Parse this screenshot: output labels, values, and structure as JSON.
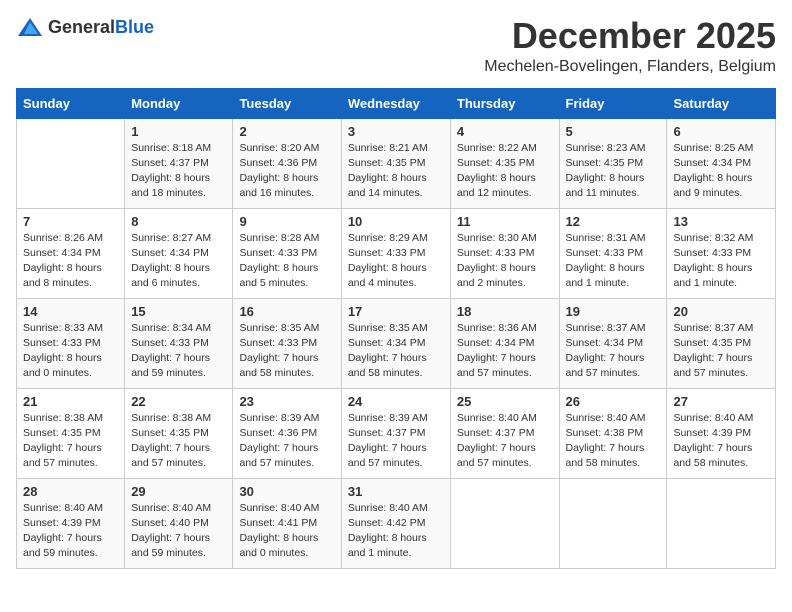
{
  "logo": {
    "general": "General",
    "blue": "Blue"
  },
  "title": {
    "month": "December 2025",
    "location": "Mechelen-Bovelingen, Flanders, Belgium"
  },
  "calendar": {
    "headers": [
      "Sunday",
      "Monday",
      "Tuesday",
      "Wednesday",
      "Thursday",
      "Friday",
      "Saturday"
    ],
    "rows": [
      [
        {
          "day": "",
          "info": ""
        },
        {
          "day": "1",
          "info": "Sunrise: 8:18 AM\nSunset: 4:37 PM\nDaylight: 8 hours\nand 18 minutes."
        },
        {
          "day": "2",
          "info": "Sunrise: 8:20 AM\nSunset: 4:36 PM\nDaylight: 8 hours\nand 16 minutes."
        },
        {
          "day": "3",
          "info": "Sunrise: 8:21 AM\nSunset: 4:35 PM\nDaylight: 8 hours\nand 14 minutes."
        },
        {
          "day": "4",
          "info": "Sunrise: 8:22 AM\nSunset: 4:35 PM\nDaylight: 8 hours\nand 12 minutes."
        },
        {
          "day": "5",
          "info": "Sunrise: 8:23 AM\nSunset: 4:35 PM\nDaylight: 8 hours\nand 11 minutes."
        },
        {
          "day": "6",
          "info": "Sunrise: 8:25 AM\nSunset: 4:34 PM\nDaylight: 8 hours\nand 9 minutes."
        }
      ],
      [
        {
          "day": "7",
          "info": "Sunrise: 8:26 AM\nSunset: 4:34 PM\nDaylight: 8 hours\nand 8 minutes."
        },
        {
          "day": "8",
          "info": "Sunrise: 8:27 AM\nSunset: 4:34 PM\nDaylight: 8 hours\nand 6 minutes."
        },
        {
          "day": "9",
          "info": "Sunrise: 8:28 AM\nSunset: 4:33 PM\nDaylight: 8 hours\nand 5 minutes."
        },
        {
          "day": "10",
          "info": "Sunrise: 8:29 AM\nSunset: 4:33 PM\nDaylight: 8 hours\nand 4 minutes."
        },
        {
          "day": "11",
          "info": "Sunrise: 8:30 AM\nSunset: 4:33 PM\nDaylight: 8 hours\nand 2 minutes."
        },
        {
          "day": "12",
          "info": "Sunrise: 8:31 AM\nSunset: 4:33 PM\nDaylight: 8 hours\nand 1 minute."
        },
        {
          "day": "13",
          "info": "Sunrise: 8:32 AM\nSunset: 4:33 PM\nDaylight: 8 hours\nand 1 minute."
        }
      ],
      [
        {
          "day": "14",
          "info": "Sunrise: 8:33 AM\nSunset: 4:33 PM\nDaylight: 8 hours\nand 0 minutes."
        },
        {
          "day": "15",
          "info": "Sunrise: 8:34 AM\nSunset: 4:33 PM\nDaylight: 7 hours\nand 59 minutes."
        },
        {
          "day": "16",
          "info": "Sunrise: 8:35 AM\nSunset: 4:33 PM\nDaylight: 7 hours\nand 58 minutes."
        },
        {
          "day": "17",
          "info": "Sunrise: 8:35 AM\nSunset: 4:34 PM\nDaylight: 7 hours\nand 58 minutes."
        },
        {
          "day": "18",
          "info": "Sunrise: 8:36 AM\nSunset: 4:34 PM\nDaylight: 7 hours\nand 57 minutes."
        },
        {
          "day": "19",
          "info": "Sunrise: 8:37 AM\nSunset: 4:34 PM\nDaylight: 7 hours\nand 57 minutes."
        },
        {
          "day": "20",
          "info": "Sunrise: 8:37 AM\nSunset: 4:35 PM\nDaylight: 7 hours\nand 57 minutes."
        }
      ],
      [
        {
          "day": "21",
          "info": "Sunrise: 8:38 AM\nSunset: 4:35 PM\nDaylight: 7 hours\nand 57 minutes."
        },
        {
          "day": "22",
          "info": "Sunrise: 8:38 AM\nSunset: 4:35 PM\nDaylight: 7 hours\nand 57 minutes."
        },
        {
          "day": "23",
          "info": "Sunrise: 8:39 AM\nSunset: 4:36 PM\nDaylight: 7 hours\nand 57 minutes."
        },
        {
          "day": "24",
          "info": "Sunrise: 8:39 AM\nSunset: 4:37 PM\nDaylight: 7 hours\nand 57 minutes."
        },
        {
          "day": "25",
          "info": "Sunrise: 8:40 AM\nSunset: 4:37 PM\nDaylight: 7 hours\nand 57 minutes."
        },
        {
          "day": "26",
          "info": "Sunrise: 8:40 AM\nSunset: 4:38 PM\nDaylight: 7 hours\nand 58 minutes."
        },
        {
          "day": "27",
          "info": "Sunrise: 8:40 AM\nSunset: 4:39 PM\nDaylight: 7 hours\nand 58 minutes."
        }
      ],
      [
        {
          "day": "28",
          "info": "Sunrise: 8:40 AM\nSunset: 4:39 PM\nDaylight: 7 hours\nand 59 minutes."
        },
        {
          "day": "29",
          "info": "Sunrise: 8:40 AM\nSunset: 4:40 PM\nDaylight: 7 hours\nand 59 minutes."
        },
        {
          "day": "30",
          "info": "Sunrise: 8:40 AM\nSunset: 4:41 PM\nDaylight: 8 hours\nand 0 minutes."
        },
        {
          "day": "31",
          "info": "Sunrise: 8:40 AM\nSunset: 4:42 PM\nDaylight: 8 hours\nand 1 minute."
        },
        {
          "day": "",
          "info": ""
        },
        {
          "day": "",
          "info": ""
        },
        {
          "day": "",
          "info": ""
        }
      ]
    ]
  }
}
